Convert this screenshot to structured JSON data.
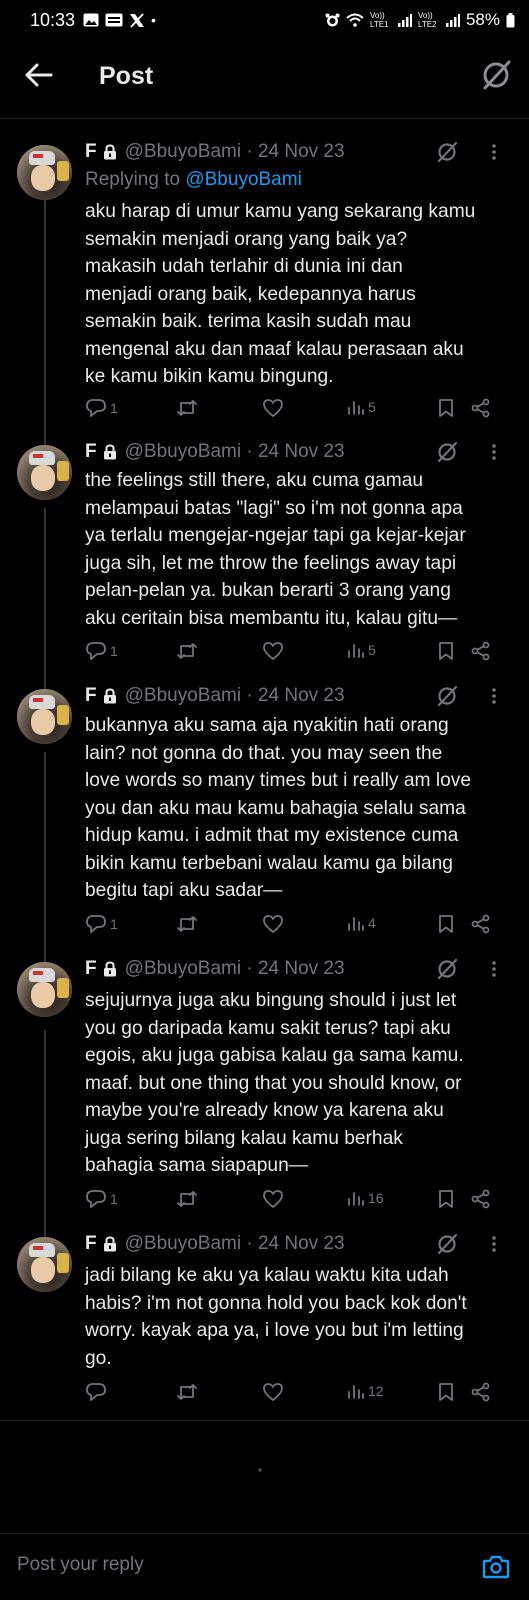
{
  "status_bar": {
    "time": "10:33",
    "notif_icons": [
      "gallery-icon",
      "klik-icon",
      "x-icon"
    ],
    "signal_labels": [
      "Vo)) LTE1",
      "Vo)) LTE2"
    ],
    "battery": "58%"
  },
  "header": {
    "title": "Post"
  },
  "posts": [
    {
      "name": "F",
      "handle": "@BbuyoBami · 24 Nov 23",
      "replying_prefix": "Replying to ",
      "replying_handle": "@BbuyoBami",
      "text": "aku harap di umur kamu yang sekarang kamu\nsemakin menjadi orang yang baik ya?\nmakasih udah terlahir di dunia ini dan\nmenjadi orang baik, kedepannya harus\nsemakin baik. terima kasih sudah mau\nmengenal aku dan maaf kalau perasaan aku\nke kamu bikin kamu bingung.",
      "replies": "1",
      "views": "5"
    },
    {
      "name": "F",
      "handle": "@BbuyoBami · 24 Nov 23",
      "text": "the feelings still there, aku cuma gamau\nmelampaui batas \"lagi\" so i'm not gonna apa\nya terlalu mengejar-ngejar tapi ga kejar-kejar\njuga sih, let me throw the feelings away tapi\npelan-pelan ya. bukan berarti 3 orang yang\naku ceritain bisa membantu itu, kalau gitu—",
      "replies": "1",
      "views": "5"
    },
    {
      "name": "F",
      "handle": "@BbuyoBami · 24 Nov 23",
      "text": "bukannya aku sama aja nyakitin hati orang\nlain? not gonna do that. you may seen the\nlove words so many times but i really am love\nyou dan aku mau kamu bahagia selalu sama\nhidup kamu. i admit that my existence cuma\nbikin kamu terbebani walau kamu ga bilang\nbegitu tapi aku sadar—",
      "replies": "1",
      "views": "4"
    },
    {
      "name": "F",
      "handle": "@BbuyoBami · 24 Nov 23",
      "text": "sejujurnya juga aku bingung should i just let\nyou go daripada kamu sakit terus? tapi aku\negois, aku juga gabisa kalau ga sama kamu.\nmaaf. but one thing that you should know, or\nmaybe you're already know ya karena aku\njuga sering bilang kalau kamu berhak\nbahagia sama siapapun—",
      "replies": "1",
      "views": "16"
    },
    {
      "name": "F",
      "handle": "@BbuyoBami · 24 Nov 23",
      "text": "jadi bilang ke aku ya kalau waktu kita udah\nhabis? i'm not gonna hold you back kok don't\nworry. kayak apa ya, i love you but i'm letting\ngo.",
      "replies": "",
      "views": "12"
    }
  ],
  "reply_bar": {
    "placeholder": "Post your reply"
  }
}
